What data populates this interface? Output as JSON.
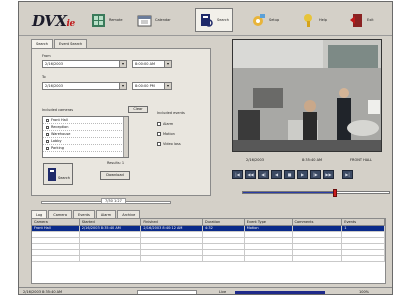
{
  "app": {
    "logo_main": "DVX",
    "logo_sub": "ie"
  },
  "toolbar": {
    "items": [
      {
        "label": "Remote",
        "icon": "grid-icon"
      },
      {
        "label": "Calendar",
        "icon": "calendar-icon"
      },
      {
        "label": "Search",
        "icon": "search-file-icon"
      },
      {
        "label": "Setup",
        "icon": "setup-icon"
      },
      {
        "label": "Help",
        "icon": "help-icon"
      },
      {
        "label": "Exit",
        "icon": "exit-icon"
      }
    ]
  },
  "search_panel": {
    "tabs": [
      "Search",
      "Event Search"
    ],
    "from_label": "From",
    "to_label": "To",
    "from_date": "2/16/2003",
    "from_time": "8:00:00 AM",
    "to_date": "2/16/2003",
    "to_time": "8:00:00 PM",
    "cameras_label": "Included cameras",
    "clear_label": "Clear",
    "cameras": [
      "Front Hall",
      "Reception",
      "Warehouse",
      "Lobby",
      "Parking"
    ],
    "triggers_label": "Included events",
    "triggers": [
      "Alarm",
      "Motion",
      "Video loss"
    ],
    "search_label": "Search",
    "results_label": "Results: 1",
    "download_label": "Download",
    "slider_value": "7/30 1:27"
  },
  "video": {
    "date": "2/16/2003",
    "time": "8:35:40 AM",
    "camera": "FRONT HALL"
  },
  "playback": {
    "buttons": [
      "|◀",
      "◀◀",
      "◀|",
      "◀",
      "■",
      "▶",
      "|▶",
      "▶▶",
      "▶|"
    ],
    "position": 0.63
  },
  "bottom_tabs": [
    "Log",
    "Camera",
    "Events",
    "Alarm",
    "Archive"
  ],
  "grid": {
    "columns": [
      "Camera",
      "Started",
      "Finished",
      "Duration",
      "Event Type",
      "Comments",
      "Events"
    ],
    "rows": [
      [
        "Front Hall",
        "2/16/2003 8:35:40 AM",
        "2/16/2003 8:40:12 AM",
        "4:32",
        "Motion",
        "",
        "1"
      ]
    ],
    "empty_rows": 5
  },
  "status": {
    "left": "2/16/2003  8:35:40 AM",
    "mid_label": "Live",
    "zoom": "100%"
  },
  "colors": {
    "accent": "#0a2a8a",
    "marker": "#cc1c1c",
    "button": "#3c4a63"
  }
}
